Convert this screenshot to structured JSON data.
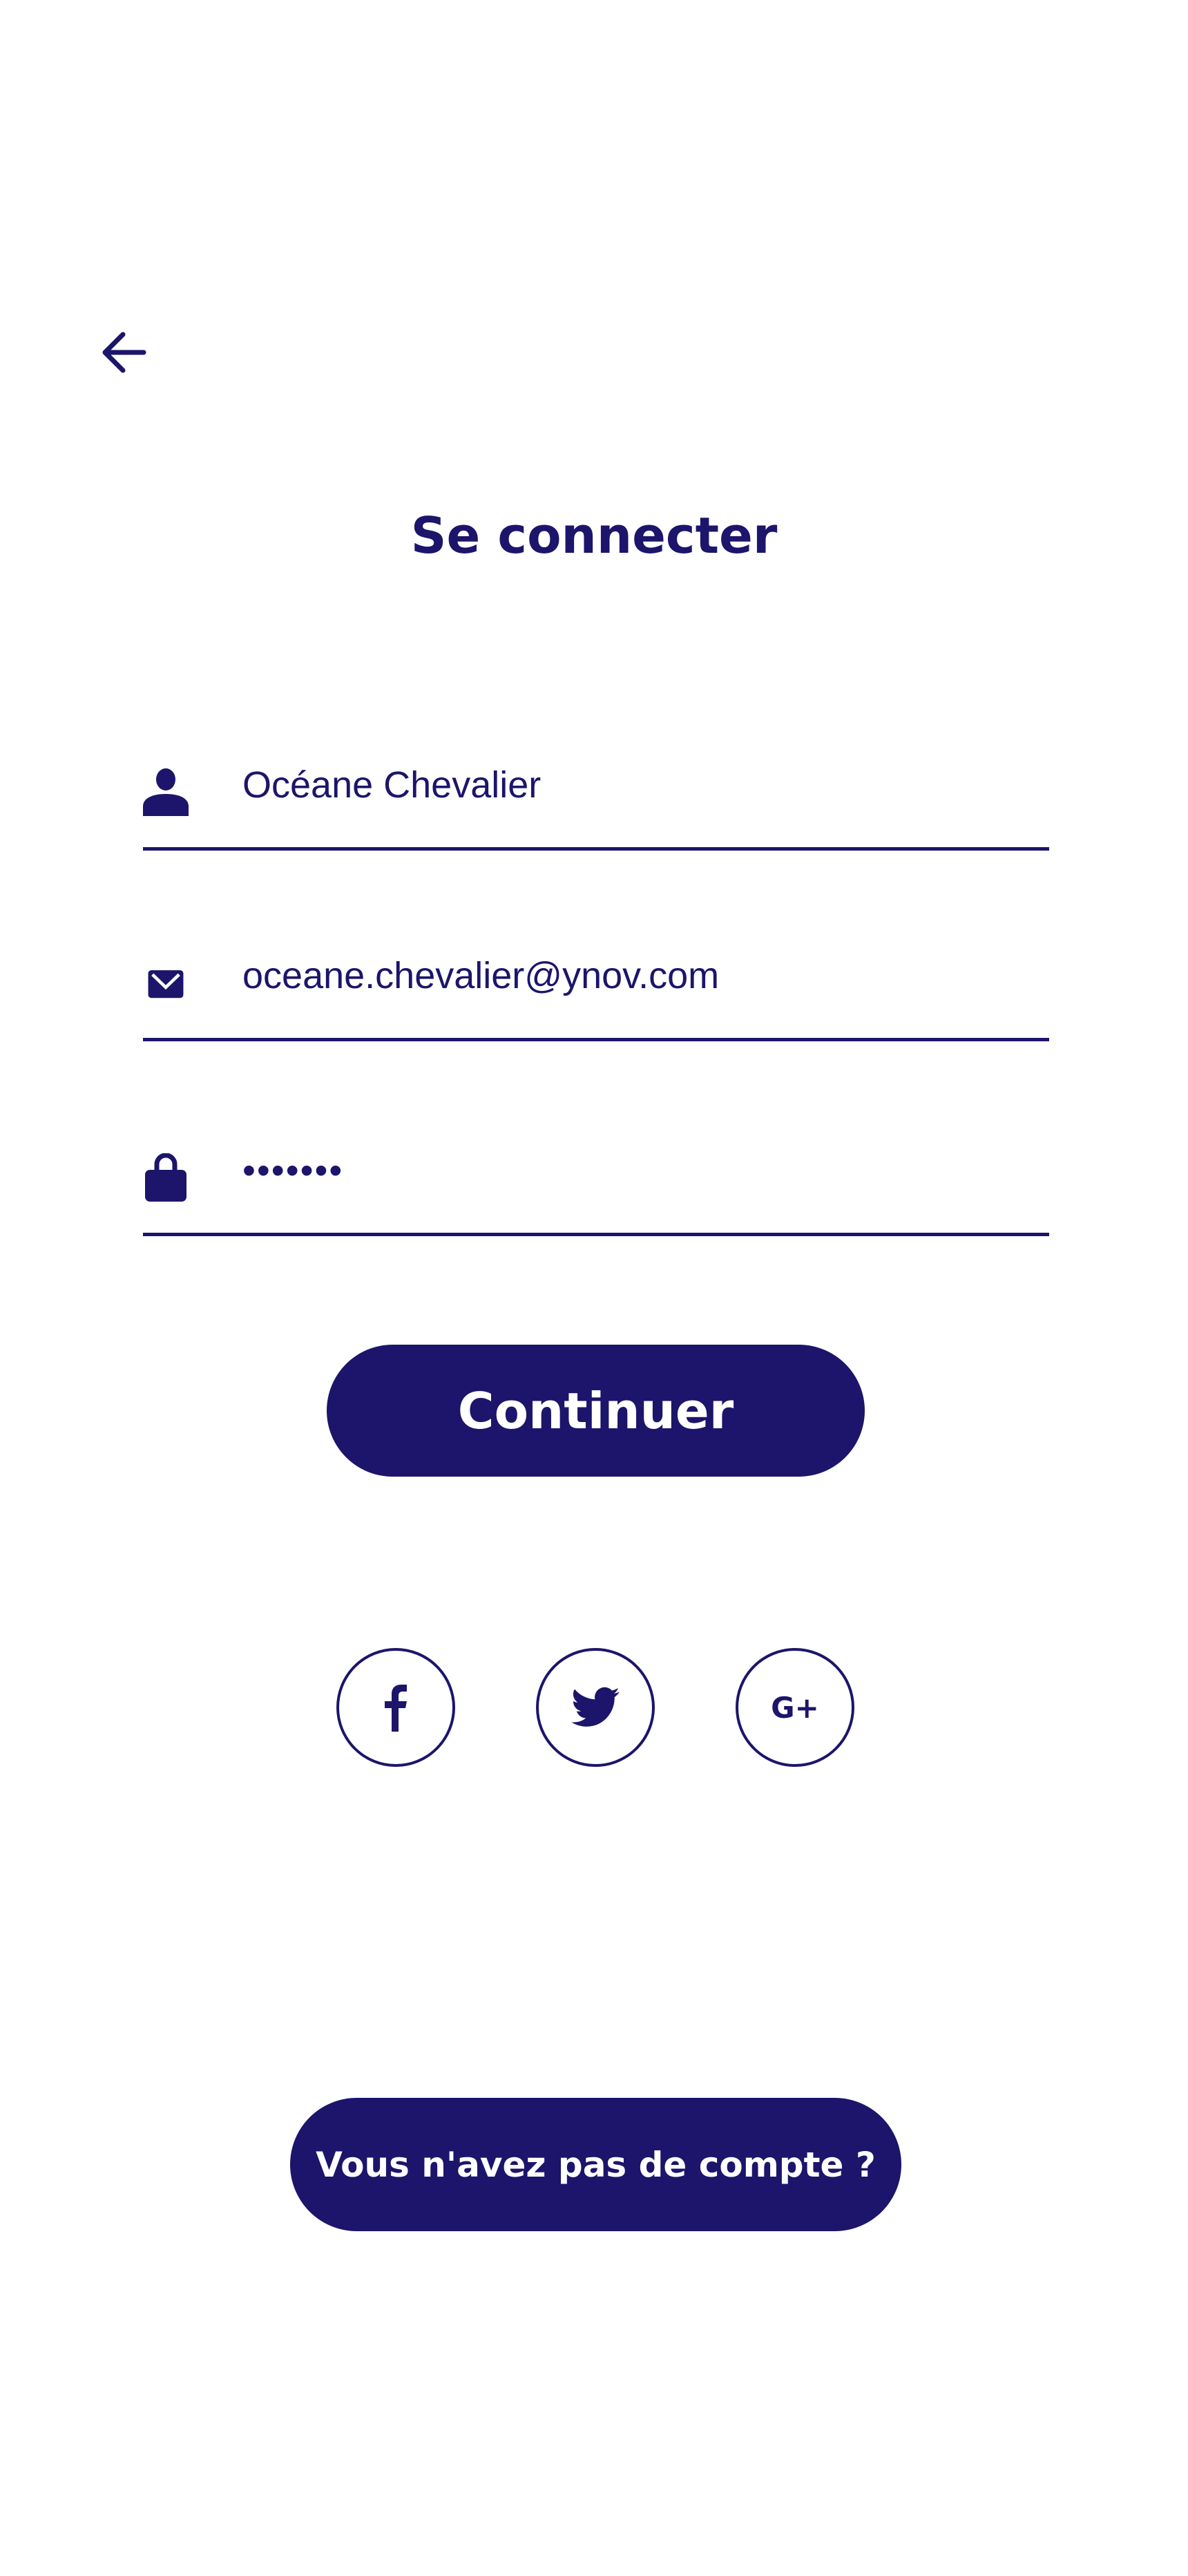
{
  "header": {
    "back_icon": "arrow-left-icon",
    "title": "Se connecter"
  },
  "form": {
    "name": {
      "icon": "user-icon",
      "value": "Océane Chevalier"
    },
    "email": {
      "icon": "envelope-icon",
      "value": "oceane.chevalier@ynov.com"
    },
    "password": {
      "icon": "lock-icon",
      "value": "•••••••"
    }
  },
  "continue_label": "Continuer",
  "social": [
    {
      "icon": "facebook-icon"
    },
    {
      "icon": "twitter-icon"
    },
    {
      "icon": "google-plus-icon",
      "label": "G+"
    }
  ],
  "signup_label": "Vous n'avez pas de compte ?",
  "colors": {
    "primary": "#1c156b",
    "background": "#ffffff"
  }
}
